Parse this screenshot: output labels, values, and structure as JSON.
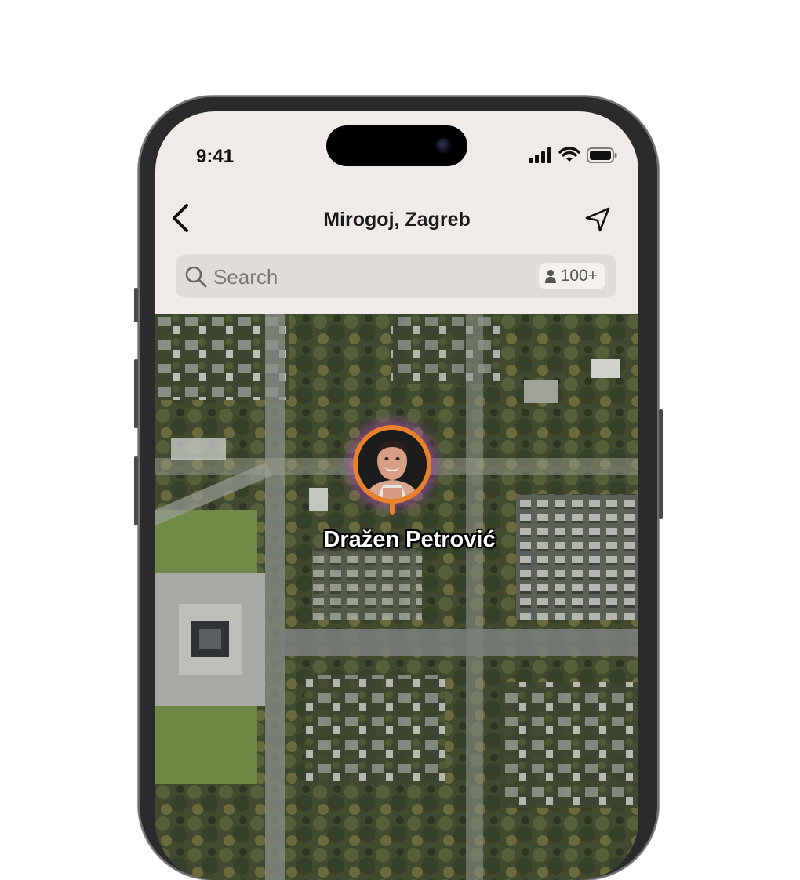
{
  "status_bar": {
    "time": "9:41",
    "icons": [
      "cellular-signal-icon",
      "wifi-icon",
      "battery-icon"
    ]
  },
  "nav": {
    "title": "Mirogoj, Zagreb",
    "back_icon": "chevron-left-icon",
    "location_icon": "navigation-arrow-icon"
  },
  "search": {
    "placeholder": "Search",
    "count_label": "100+",
    "count_icon": "person-icon"
  },
  "map": {
    "type": "satellite",
    "pin": {
      "name": "Dražen Petrović",
      "ring_color": "#e9812a",
      "glow_color": "#be46c8"
    }
  },
  "colors": {
    "background": "#f0ebe6",
    "search_field": "#e1dcd7",
    "accent": "#e9812a"
  }
}
